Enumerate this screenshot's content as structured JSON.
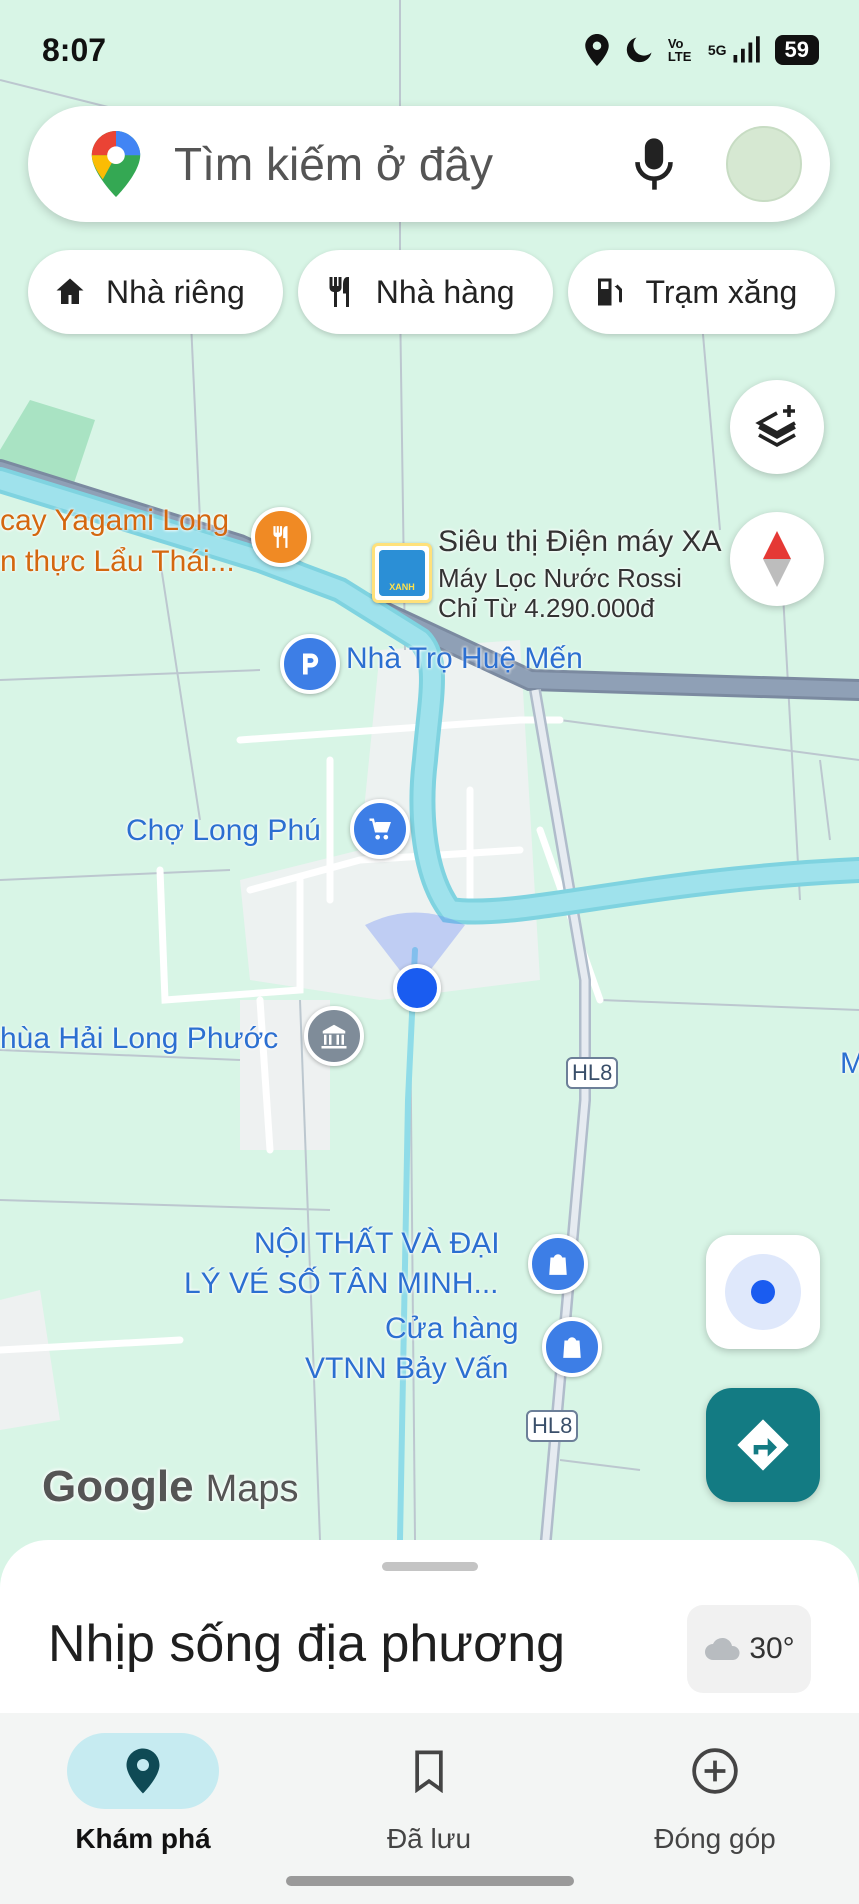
{
  "status_bar": {
    "time": "8:07",
    "volte": "Vo LTE",
    "network": "5G",
    "battery": "59"
  },
  "search": {
    "placeholder": "Tìm kiếm ở đây"
  },
  "chips": [
    {
      "label": "Nhà riêng",
      "icon": "home-icon"
    },
    {
      "label": "Nhà hàng",
      "icon": "restaurant-icon"
    },
    {
      "label": "Trạm xăng",
      "icon": "gas-station-icon"
    }
  ],
  "map": {
    "places": {
      "restaurant_line1": "cay Yagami Long",
      "restaurant_line2": "n thực Lẩu Thái...",
      "store_name": "Siêu thị Điện máy XA",
      "store_ad_line1": "Máy Lọc Nước Rossi",
      "store_ad_line2": "Chỉ Từ 4.290.000đ",
      "store_logo_text": "XANH",
      "guesthouse": "Nhà Trọ Huệ Mến",
      "market": "Chợ Long Phú",
      "pagoda": "hùa Hải Long Phước",
      "furniture_line1": "NỘI THẤT VÀ ĐẠI",
      "furniture_line2": "LÝ VÉ SỐ TÂN MINH...",
      "shop_line1": "Cửa hàng",
      "shop_line2": "VTNN Bảy Vấn",
      "edge_label": "M"
    },
    "road_shields": [
      "HL8",
      "HL8"
    ],
    "watermark_google": "Google",
    "watermark_maps": "Maps"
  },
  "sheet": {
    "title": "Nhịp sống địa phương",
    "temperature": "30°"
  },
  "bottom_nav": [
    {
      "label": "Khám phá",
      "icon": "explore-pin-icon",
      "active": true
    },
    {
      "label": "Đã lưu",
      "icon": "bookmark-icon",
      "active": false
    },
    {
      "label": "Đóng góp",
      "icon": "add-circle-icon",
      "active": false
    }
  ],
  "colors": {
    "map_green": "#d8f5e6",
    "road": "#ffffff",
    "highway": "#8797ad",
    "river": "#8fdce8",
    "blue_poi": "#2c6fd1",
    "orange_poi": "#d4670f",
    "nav_active": "#c6ebf1",
    "directions_fab": "#137b83",
    "location_dot": "#1a5cf0"
  }
}
